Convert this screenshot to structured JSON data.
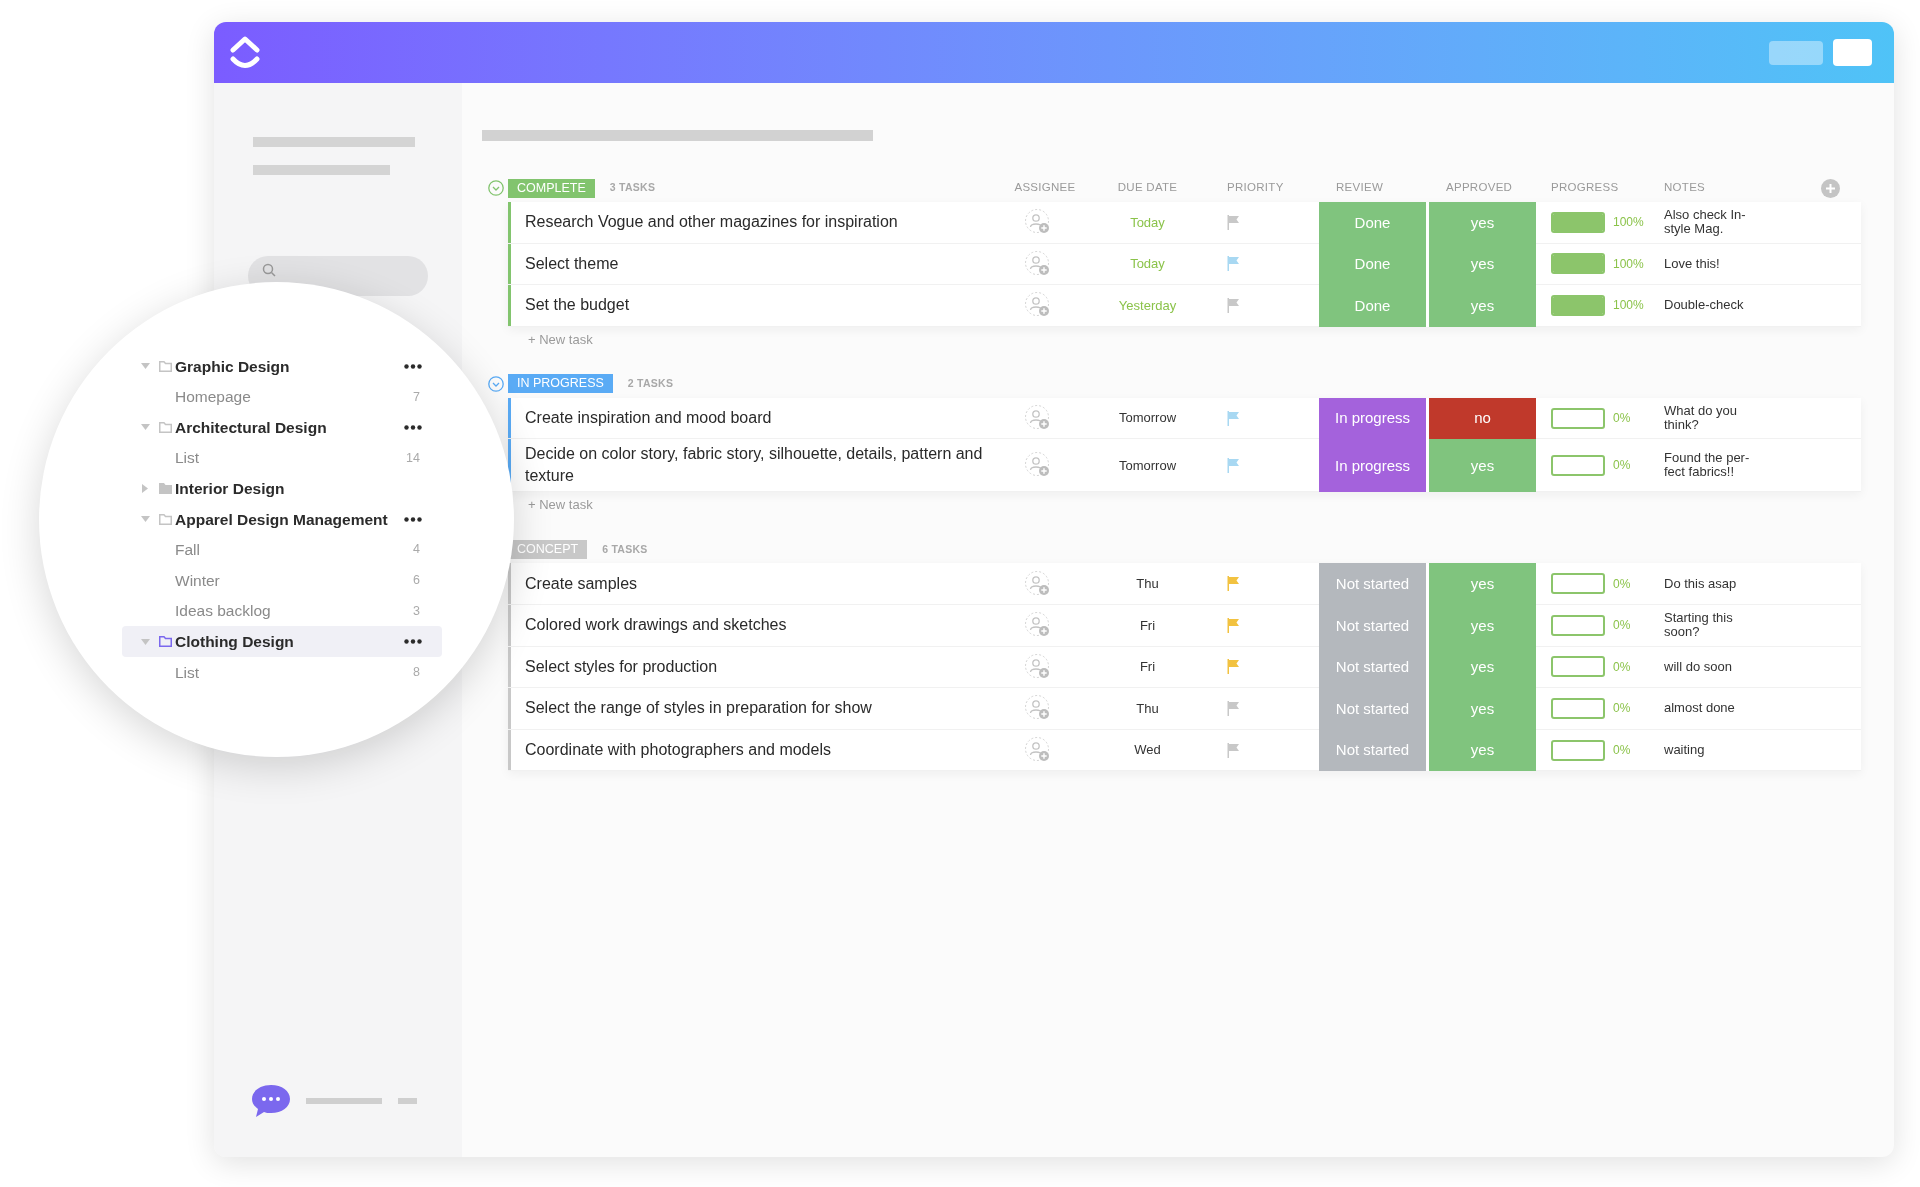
{
  "sidebar": {
    "tree": [
      {
        "label": "Graphic Design",
        "expanded": true,
        "selected": false,
        "menu": true,
        "children": [
          {
            "label": "Homepage",
            "count": "7",
            "selected": false
          }
        ]
      },
      {
        "label": "Architectural Design",
        "expanded": true,
        "selected": false,
        "menu": true,
        "children": [
          {
            "label": "List",
            "count": "14",
            "selected": false
          }
        ]
      },
      {
        "label": "Interior Design",
        "expanded": false,
        "selected": false,
        "menu": false
      },
      {
        "label": "Apparel Design Management",
        "expanded": true,
        "selected": false,
        "menu": true,
        "children": [
          {
            "label": "Fall",
            "count": "4",
            "selected": false
          },
          {
            "label": "Winter",
            "count": "6",
            "selected": false
          },
          {
            "label": "Ideas backlog",
            "count": "3",
            "selected": false
          }
        ]
      },
      {
        "label": "Clothing Design",
        "expanded": true,
        "selected": true,
        "menu": true,
        "children": [
          {
            "label": "List",
            "count": "8",
            "selected": false
          }
        ]
      }
    ]
  },
  "table": {
    "columns": [
      "ASSIGNEE",
      "DUE DATE",
      "PRIORITY",
      "REVIEW",
      "APPROVED",
      "PROGRESS",
      "NOTES"
    ],
    "groups": [
      {
        "status": "COMPLETE",
        "color": "#82c46e",
        "count": "3 TASKS",
        "toggle": true,
        "new_task": "+ New task",
        "tasks": [
          {
            "name": "Research Vogue and other magazines for inspiration",
            "due": {
              "text": "Today",
              "color": "#8bc34a"
            },
            "priority": {
              "color": "#c8c8c8"
            },
            "review": {
              "text": "Done",
              "color": "#80c47e"
            },
            "approved": {
              "text": "yes",
              "color": "#80c47e"
            },
            "progress": {
              "level": 1,
              "reading": "100%"
            },
            "notes": "Also check In-style Mag."
          },
          {
            "name": "Select theme",
            "due": {
              "text": "Today",
              "color": "#8bc34a"
            },
            "priority": {
              "color": "#a8d8f2"
            },
            "review": {
              "text": "Done",
              "color": "#80c47e"
            },
            "approved": {
              "text": "yes",
              "color": "#80c47e"
            },
            "progress": {
              "level": 1,
              "reading": "100%"
            },
            "notes": "Love this!"
          },
          {
            "name": "Set the budget",
            "due": {
              "text": "Yesterday",
              "color": "#8bc34a"
            },
            "priority": {
              "color": "#c8c8c8"
            },
            "review": {
              "text": "Done",
              "color": "#80c47e"
            },
            "approved": {
              "text": "yes",
              "color": "#80c47e"
            },
            "progress": {
              "level": 1,
              "reading": "100%"
            },
            "notes": "Double-check"
          }
        ]
      },
      {
        "status": "IN PROGRESS",
        "color": "#5aabf5",
        "count": "2 TASKS",
        "toggle": true,
        "new_task": "+ New task",
        "tasks": [
          {
            "name": "Create inspiration and mood board",
            "due": {
              "text": "Tomorrow",
              "color": "#333333"
            },
            "priority": {
              "color": "#a8d8f2"
            },
            "review": {
              "text": "In progress",
              "color": "#a462dc"
            },
            "approved": {
              "text": "no",
              "color": "#c0392b"
            },
            "progress": {
              "level": 0,
              "reading": "0%"
            },
            "notes": "What do you think?"
          },
          {
            "name": "Decide on color story, fabric story, silhouette, details, pattern and texture",
            "due": {
              "text": "Tomorrow",
              "color": "#333333"
            },
            "priority": {
              "color": "#a8d8f2"
            },
            "review": {
              "text": "In progress",
              "color": "#a462dc"
            },
            "approved": {
              "text": "yes",
              "color": "#80c47e"
            },
            "progress": {
              "level": 0,
              "reading": "0%"
            },
            "notes": "Found the per-fect fabrics!!"
          }
        ]
      },
      {
        "status": "CONCEPT",
        "color": "#c8c8c8",
        "count": "6 TASKS",
        "toggle": false,
        "tasks": [
          {
            "name": "Create samples",
            "due": {
              "text": "Thu",
              "color": "#333333"
            },
            "priority": {
              "color": "#f2c240"
            },
            "review": {
              "text": "Not started",
              "color": "#b4b8bd"
            },
            "approved": {
              "text": "yes",
              "color": "#80c47e"
            },
            "progress": {
              "level": 0,
              "reading": "0%"
            },
            "notes": "Do this asap"
          },
          {
            "name": "Colored work drawings and sketches",
            "due": {
              "text": "Fri",
              "color": "#333333"
            },
            "priority": {
              "color": "#f2c240"
            },
            "review": {
              "text": "Not started",
              "color": "#b4b8bd"
            },
            "approved": {
              "text": "yes",
              "color": "#80c47e"
            },
            "progress": {
              "level": 0,
              "reading": "0%"
            },
            "notes": "Starting this soon?"
          },
          {
            "name": "Select styles for production",
            "due": {
              "text": "Fri",
              "color": "#333333"
            },
            "priority": {
              "color": "#f2c240"
            },
            "review": {
              "text": "Not started",
              "color": "#b4b8bd"
            },
            "approved": {
              "text": "yes",
              "color": "#80c47e"
            },
            "progress": {
              "level": 0,
              "reading": "0%"
            },
            "notes": "will do soon"
          },
          {
            "name": "Select the range of styles in preparation for show",
            "due": {
              "text": "Thu",
              "color": "#333333"
            },
            "priority": {
              "color": "#c8c8c8"
            },
            "review": {
              "text": "Not started",
              "color": "#b4b8bd"
            },
            "approved": {
              "text": "yes",
              "color": "#80c47e"
            },
            "progress": {
              "level": 0,
              "reading": "0%"
            },
            "notes": "almost done"
          },
          {
            "name": "Coordinate with photographers and models",
            "due": {
              "text": "Wed",
              "color": "#333333"
            },
            "priority": {
              "color": "#c8c8c8"
            },
            "review": {
              "text": "Not started",
              "color": "#b4b8bd"
            },
            "approved": {
              "text": "yes",
              "color": "#80c47e"
            },
            "progress": {
              "level": 0,
              "reading": "0%"
            },
            "notes": "waiting"
          }
        ]
      }
    ]
  }
}
